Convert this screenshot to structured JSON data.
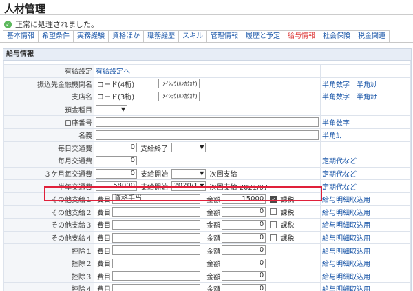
{
  "page": {
    "title": "人材管理"
  },
  "status": {
    "message": "正常に処理されました。",
    "color": "#5cb85c"
  },
  "tabs": [
    {
      "label": "基本情報",
      "active": false
    },
    {
      "label": "希望条件",
      "active": false
    },
    {
      "label": "実務経験",
      "active": false
    },
    {
      "label": "資格ほか",
      "active": false
    },
    {
      "label": "職務経歴",
      "active": false
    },
    {
      "label": "スキル",
      "active": false
    },
    {
      "label": "管理情報",
      "active": false
    },
    {
      "label": "履歴と予定",
      "active": false
    },
    {
      "label": "給与情報",
      "active": true
    },
    {
      "label": "社会保険",
      "active": false
    },
    {
      "label": "税金関連",
      "active": false
    }
  ],
  "section": {
    "title": "給与情報",
    "yukyu": {
      "label": "有給設定",
      "link": "有給設定へ"
    },
    "bank": {
      "label": "振込先金融機関名",
      "code_label": "コード(4桁)",
      "kana_label": "ﾒｲｼｮｳ(ﾊﾝｶｸｶﾅ)",
      "hint": "半角数字　半角ｶﾅ"
    },
    "branch": {
      "label": "支店名",
      "code_label": "コード(3桁)",
      "kana_label": "ﾒｲｼｮｳ(ﾊﾝｶｸｶﾅ)",
      "hint": "半角数字　半角ｶﾅ"
    },
    "deposit": {
      "label": "預金種目"
    },
    "account": {
      "label": "口座番号",
      "hint": "半角数字"
    },
    "holder": {
      "label": "名義",
      "hint": "半角ｶﾅ"
    },
    "daily": {
      "label": "毎日交通費",
      "value": "0",
      "end_label": "支給終了"
    },
    "monthly": {
      "label": "毎月交通費",
      "value": "0",
      "hint": "定期代など"
    },
    "three": {
      "label": "３ケ月毎交通費",
      "value": "0",
      "start_label": "支給開始",
      "next_label": "次回支給",
      "hint": "定期代など"
    },
    "half": {
      "label": "半年交通費",
      "value": "58000",
      "start_label": "支給開始",
      "start_value": "2020/1",
      "next_label": "次回支給 2021/07",
      "hint": "定期代など"
    },
    "other": [
      {
        "label": "その他支給１",
        "item_label": "費目",
        "item": "資格手当",
        "amount_label": "金額",
        "amount": "15000",
        "taxed": true,
        "tax_label": "課税",
        "hint": "給与明細取込用"
      },
      {
        "label": "その他支給２",
        "item_label": "費目",
        "item": "",
        "amount_label": "金額",
        "amount": "0",
        "taxed": false,
        "tax_label": "課税",
        "hint": "給与明細取込用"
      },
      {
        "label": "その他支給３",
        "item_label": "費目",
        "item": "",
        "amount_label": "金額",
        "amount": "0",
        "taxed": false,
        "tax_label": "課税",
        "hint": "給与明細取込用"
      },
      {
        "label": "その他支給４",
        "item_label": "費目",
        "item": "",
        "amount_label": "金額",
        "amount": "0",
        "taxed": false,
        "tax_label": "課税",
        "hint": "給与明細取込用"
      }
    ],
    "deductions": [
      {
        "label": "控除１",
        "item_label": "費目",
        "amount_label": "金額",
        "amount": "0",
        "hint": "給与明細取込用"
      },
      {
        "label": "控除２",
        "item_label": "費目",
        "amount_label": "金額",
        "amount": "0",
        "hint": "給与明細取込用"
      },
      {
        "label": "控除３",
        "item_label": "費目",
        "amount_label": "金額",
        "amount": "0",
        "hint": "給与明細取込用"
      },
      {
        "label": "控除４",
        "item_label": "費目",
        "amount_label": "金額",
        "amount": "0",
        "hint": "給与明細取込用"
      }
    ]
  }
}
